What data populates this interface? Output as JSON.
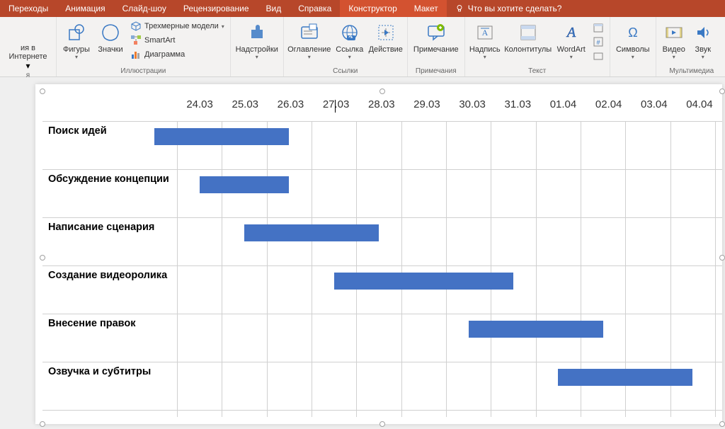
{
  "ribbon_tabs": {
    "transitions": "Переходы",
    "animation": "Анимация",
    "slideshow": "Слайд-шоу",
    "review": "Рецензирование",
    "view": "Вид",
    "help": "Справка",
    "design": "Конструктор",
    "layout": "Макет",
    "tell_me": "Что вы хотите сделать?"
  },
  "ribbon": {
    "online_frag": "ия в Интернете",
    "shapes": "Фигуры",
    "icons": "Значки",
    "models3d": "Трехмерные модели",
    "smartart": "SmartArt",
    "chart": "Диаграмма",
    "group_illustrations": "Иллюстрации",
    "addins": "Надстройки",
    "toc": "Оглавление",
    "link": "Ссылка",
    "action": "Действие",
    "group_links": "Ссылки",
    "comment": "Примечание",
    "group_comments": "Примечания",
    "textbox": "Надпись",
    "headerfooter": "Колонтитулы",
    "wordart": "WordArt",
    "group_text": "Текст",
    "symbols": "Символы",
    "video": "Видео",
    "audio": "Звук",
    "group_media": "Мультимедиа"
  },
  "chart_data": {
    "type": "bar",
    "title": "",
    "xlabel": "",
    "ylabel": "",
    "categories": [
      "24.03",
      "25.03",
      "26.03",
      "27.03",
      "28.03",
      "29.03",
      "30.03",
      "31.03",
      "01.04",
      "02.04",
      "03.04",
      "04.04"
    ],
    "tasks": [
      {
        "name": "Поиск идей",
        "start": 0,
        "duration": 3
      },
      {
        "name": "Обсуждение концепции",
        "start": 1,
        "duration": 2
      },
      {
        "name": "Написание сценария",
        "start": 2,
        "duration": 3
      },
      {
        "name": "Создание видеоролика",
        "start": 4,
        "duration": 4
      },
      {
        "name": "Внесение правок",
        "start": 7,
        "duration": 3
      },
      {
        "name": "Озвучка и субтитры",
        "start": 9,
        "duration": 3
      }
    ],
    "xlim": [
      0,
      12
    ]
  }
}
